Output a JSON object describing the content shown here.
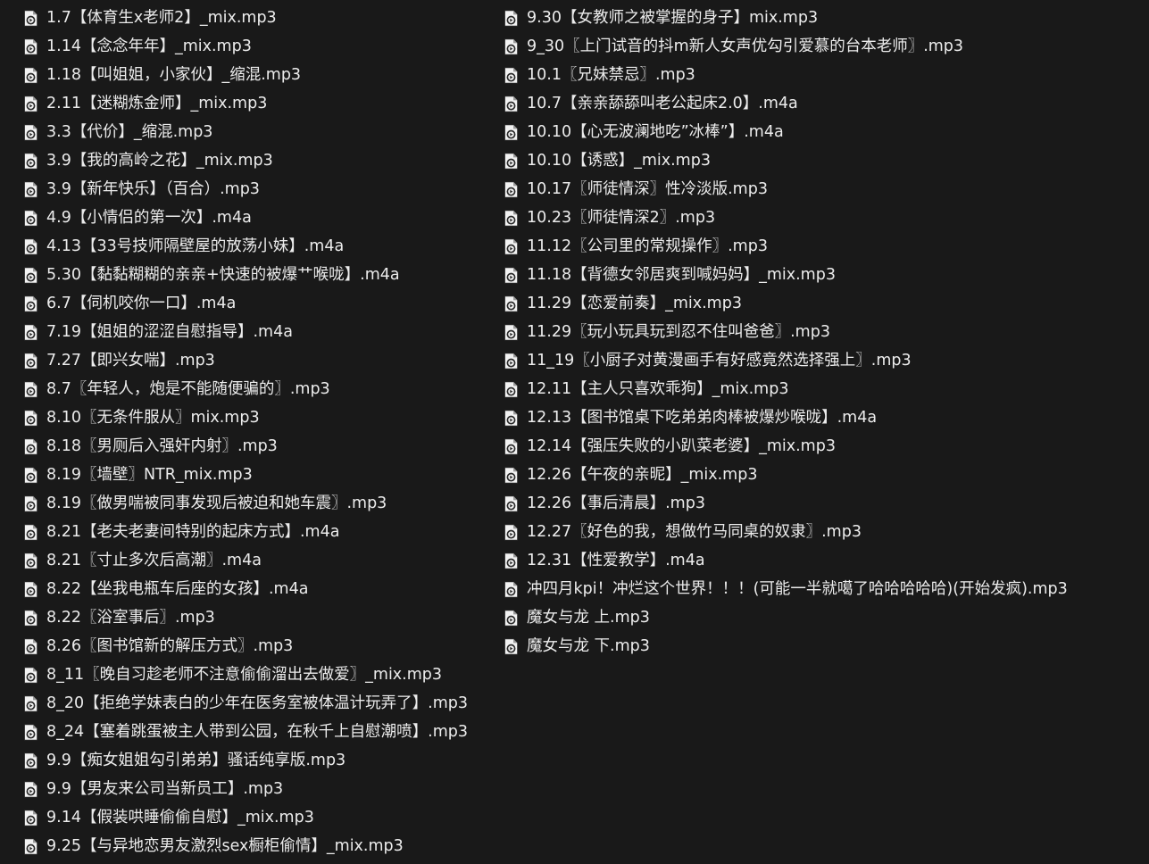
{
  "icons": {
    "file_icon": "audio-file-icon",
    "colors": {
      "page": "#f2f2f2",
      "fold": "#9a9a9a",
      "outline": "#2a2a2a",
      "symbol": "#2a2a2a"
    }
  },
  "files": {
    "left": [
      {
        "name": "1.7【体育生x老师2】_mix.mp3"
      },
      {
        "name": "1.14【念念年年】_mix.mp3"
      },
      {
        "name": "1.18【叫姐姐，小家伙】_缩混.mp3"
      },
      {
        "name": "2.11【迷糊炼金师】_mix.mp3"
      },
      {
        "name": "3.3【代价】_缩混.mp3"
      },
      {
        "name": "3.9【我的高岭之花】_mix.mp3"
      },
      {
        "name": "3.9【新年快乐】（百合）.mp3"
      },
      {
        "name": "4.9【小情侣的第一次】.m4a"
      },
      {
        "name": "4.13【33号技师隔壁屋的放荡小妹】.m4a"
      },
      {
        "name": "5.30【黏黏糊糊的亲亲+快速的被爆艹喉咙】.m4a"
      },
      {
        "name": "6.7【伺机咬你一口】.m4a"
      },
      {
        "name": "7.19【姐姐的涩涩自慰指导】.m4a"
      },
      {
        "name": "7.27【即兴女喘】.mp3"
      },
      {
        "name": "8.7〖年轻人，炮是不能随便骗的〗.mp3"
      },
      {
        "name": "8.10〖无条件服从〗mix.mp3"
      },
      {
        "name": "8.18〖男厕后入强奸内射〗.mp3"
      },
      {
        "name": "8.19〖墙壁〗NTR_mix.mp3"
      },
      {
        "name": "8.19〖做男喘被同事发现后被迫和她车震〗.mp3"
      },
      {
        "name": "8.21【老夫老妻间特别的起床方式】.m4a"
      },
      {
        "name": "8.21〖寸止多次后高潮〗.m4a"
      },
      {
        "name": "8.22【坐我电瓶车后座的女孩】.m4a"
      },
      {
        "name": "8.22〖浴室事后〗.mp3"
      },
      {
        "name": "8.26〖图书馆新的解压方式〗.mp3"
      },
      {
        "name": "8_11〖晚自习趁老师不注意偷偷溜出去做爱〗_mix.mp3"
      },
      {
        "name": "8_20【拒绝学妹表白的少年在医务室被体温计玩弄了】.mp3"
      },
      {
        "name": "8_24【塞着跳蛋被主人带到公园，在秋千上自慰潮喷】.mp3"
      },
      {
        "name": "9.9【痴女姐姐勾引弟弟】骚话纯享版.mp3"
      },
      {
        "name": "9.9【男友来公司当新员工】.mp3"
      },
      {
        "name": "9.14【假装哄睡偷偷自慰】_mix.mp3"
      },
      {
        "name": "9.25【与异地恋男友激烈sex橱柜偷情】_mix.mp3"
      }
    ],
    "right": [
      {
        "name": "9.30【女教师之被掌握的身子】mix.mp3"
      },
      {
        "name": "9_30〖上门试音的抖m新人女声优勾引爱慕的台本老师〗.mp3"
      },
      {
        "name": "10.1〖兄妹禁忌〗.mp3"
      },
      {
        "name": "10.7【亲亲舔舔叫老公起床2.0】.m4a"
      },
      {
        "name": "10.10【心无波澜地吃”冰棒”】.m4a"
      },
      {
        "name": "10.10【诱惑】_mix.mp3"
      },
      {
        "name": "10.17〖师徒情深〗性冷淡版.mp3"
      },
      {
        "name": "10.23〖师徒情深2〗.mp3"
      },
      {
        "name": "11.12〖公司里的常规操作〗.mp3"
      },
      {
        "name": "11.18【背德女邻居爽到喊妈妈】_mix.mp3"
      },
      {
        "name": "11.29【恋爱前奏】_mix.mp3"
      },
      {
        "name": "11.29〖玩小玩具玩到忍不住叫爸爸〗.mp3"
      },
      {
        "name": "11_19〖小厨子对黄漫画手有好感竟然选择强上〗.mp3"
      },
      {
        "name": "12.11【主人只喜欢乖狗】_mix.mp3"
      },
      {
        "name": "12.13【图书馆桌下吃弟弟肉棒被爆炒喉咙】.m4a"
      },
      {
        "name": "12.14【强压失败的小趴菜老婆】_mix.mp3"
      },
      {
        "name": "12.26【午夜的亲昵】_mix.mp3"
      },
      {
        "name": "12.26【事后清晨】.mp3"
      },
      {
        "name": "12.27〖好色的我，想做竹马同桌的奴隶〗.mp3"
      },
      {
        "name": "12.31【性爱教学】.m4a"
      },
      {
        "name": "冲四月kpi！冲烂这个世界！！！(可能一半就噶了哈哈哈哈哈)(开始发疯).mp3"
      },
      {
        "name": "魔女与龙 上.mp3"
      },
      {
        "name": "魔女与龙 下.mp3"
      }
    ]
  }
}
